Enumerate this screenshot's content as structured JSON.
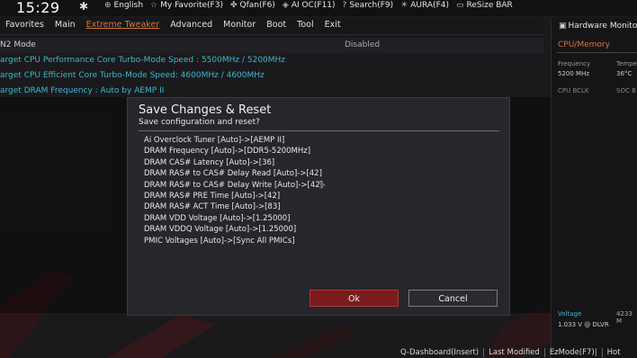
{
  "topbar": {
    "time": "15:29",
    "items": [
      {
        "icon": "globe-icon",
        "label": "English"
      },
      {
        "icon": "star-icon",
        "label": "My Favorite(F3)"
      },
      {
        "icon": "fan-icon",
        "label": "Qfan(F6)"
      },
      {
        "icon": "ai-oc-icon",
        "label": "AI OC(F11)"
      },
      {
        "icon": "help-icon",
        "label": "Search(F9)"
      },
      {
        "icon": "aura-icon",
        "label": "AURA(F4)"
      },
      {
        "icon": "resize-bar-icon",
        "label": "ReSize BAR"
      }
    ]
  },
  "menu": {
    "items": [
      "Favorites",
      "Main",
      "Extreme Tweaker",
      "Advanced",
      "Monitor",
      "Boot",
      "Tool",
      "Exit"
    ],
    "active": "Extreme Tweaker"
  },
  "main": {
    "rows": [
      {
        "label": "N2 Mode",
        "value": "Disabled"
      },
      {
        "label": "arget CPU Performance Core Turbo-Mode Speed : 5500MHz / 5200MHz",
        "value": ""
      },
      {
        "label": "arget CPU Efficient Core Turbo-Mode Speed: 4600MHz / 4600MHz",
        "value": ""
      },
      {
        "label": "arget DRAM Frequency : Auto by AEMP II",
        "value": ""
      }
    ]
  },
  "hw": {
    "title": "Hardware Monito",
    "section": "CPU/Memory",
    "freq_label": "Frequency",
    "temp_label": "Tempe",
    "freq_value": "5200 MHz",
    "temp_value": "36°C",
    "bclk_label": "CPU BCLK",
    "soc_label": "SOC B",
    "bottom_label": "Voltage",
    "bottom_value": "1.033 V @ DLVR",
    "bottom_right": "4233 M"
  },
  "dialog": {
    "title": "Save Changes & Reset",
    "subtitle": "Save configuration and reset?",
    "changes": [
      "Ai Overclock Tuner [Auto]->[AEMP II]",
      "DRAM Frequency [Auto]->[DDR5-5200MHz]",
      "DRAM CAS# Latency [Auto]->[36]",
      "DRAM RAS# to CAS# Delay Read [Auto]->[42]",
      "DRAM RAS# to CAS# Delay Write [Auto]->[42]",
      "DRAM RAS# PRE Time [Auto]->[42]",
      "DRAM RAS# ACT Time [Auto]->[83]",
      "DRAM VDD Voltage [Auto]->[1.25000]",
      "DRAM VDDQ Voltage [Auto]->[1.25000]",
      "PMIC Voltages [Auto]->[Sync All PMICs]"
    ],
    "ok_label": "Ok",
    "cancel_label": "Cancel"
  },
  "bottombar": {
    "items": [
      "Q-Dashboard(Insert)",
      "Last Modified",
      "EzMode(F7)|",
      "Hot"
    ]
  },
  "colors": {
    "accent": "#d4763a",
    "cyan": "#3fb6cf",
    "ok_bg": "#7a1c1e",
    "background": "#1a1a1c"
  }
}
